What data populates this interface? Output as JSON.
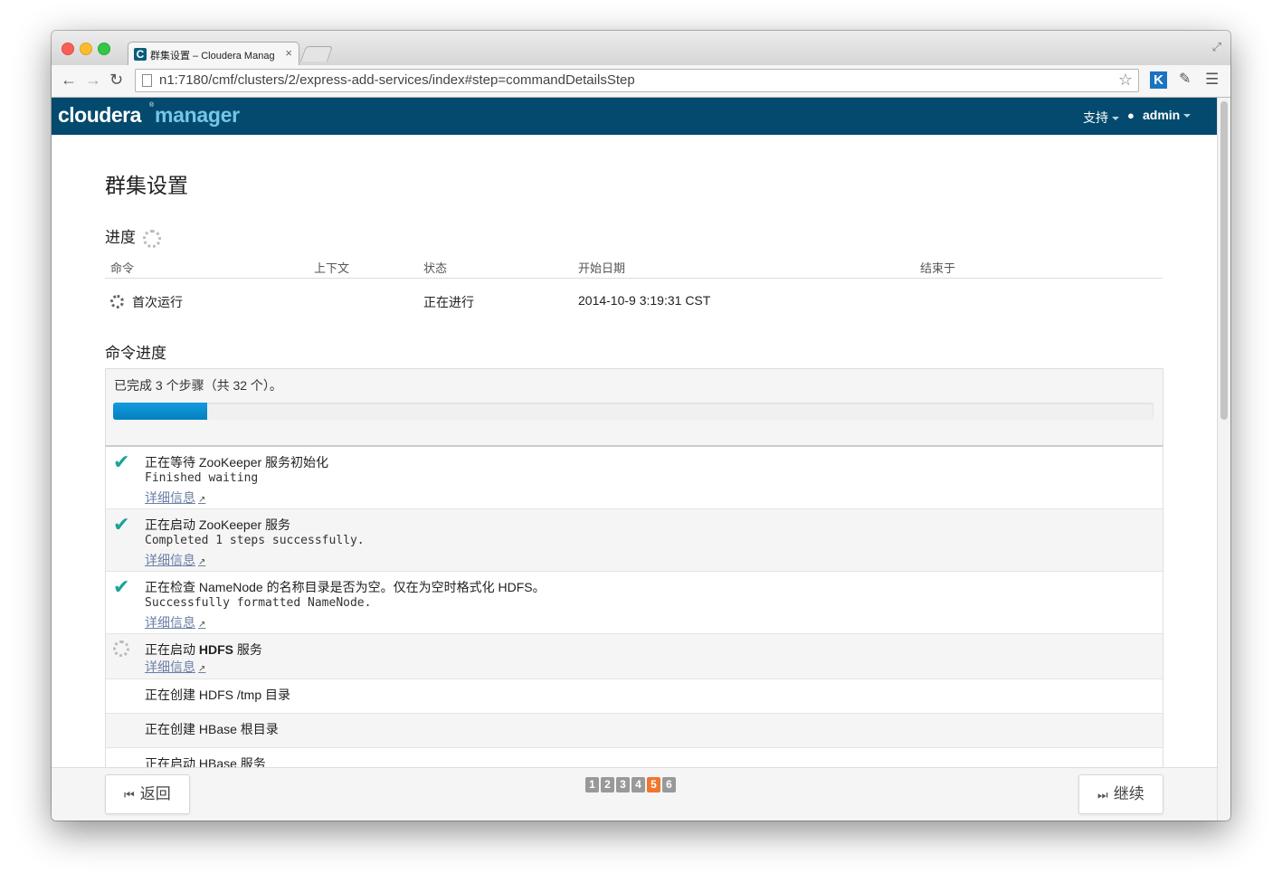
{
  "browser": {
    "tab_title": "群集设置 – Cloudera Manag",
    "tab_favicon": "C",
    "close_glyph": "×",
    "url": "n1:7180/cmf/clusters/2/express-add-services/index#step=commandDetailsStep",
    "ext_k": "K"
  },
  "header": {
    "logo_a": "cloudera",
    "logo_mark": "®",
    "logo_b": "manager",
    "support": "支持",
    "user": "admin",
    "bg": "#034a6e",
    "accent": "#77c5ea"
  },
  "page": {
    "title": "群集设置",
    "progress_heading": "进度",
    "table_headers": [
      "命令",
      "上下文",
      "状态",
      "开始日期",
      "结束于"
    ],
    "command_row": {
      "command": "首次运行",
      "context": "",
      "status": "正在进行",
      "start": "2014-10-9 3:19:31 CST",
      "end": ""
    },
    "cmd_progress_heading": "命令进度",
    "summary": "已完成 3 个步骤（共 32 个）。",
    "progress_fraction": 0.09,
    "steps": [
      {
        "state": "done",
        "title": "正在等待 ZooKeeper 服务初始化",
        "message": "Finished waiting",
        "link": "详细信息"
      },
      {
        "state": "done",
        "title": "正在启动 ZooKeeper 服务",
        "message": "Completed 1 steps successfully.",
        "link": "详细信息"
      },
      {
        "state": "done",
        "title": "正在检查 NameNode 的名称目录是否为空。仅在为空时格式化 HDFS。",
        "message": "Successfully formatted NameNode.",
        "link": "详细信息"
      },
      {
        "state": "running",
        "title_pre": "正在启动 ",
        "title_bold": "HDFS",
        "title_post": " 服务",
        "link": "详细信息"
      },
      {
        "state": "pending",
        "title": "正在创建 HDFS /tmp 目录"
      },
      {
        "state": "pending",
        "title": "正在创建 HBase 根目录"
      },
      {
        "state": "pending",
        "title": "正在启动 HBase 服务"
      }
    ]
  },
  "footer": {
    "back": "返回",
    "continue": "继续",
    "pages": [
      "1",
      "2",
      "3",
      "4",
      "5",
      "6"
    ],
    "active_page": "5"
  },
  "icons": {
    "check": "✔",
    "external": "↗",
    "back_icon": "⏮",
    "forward_icon": "⏭",
    "user_icon": "👤"
  }
}
